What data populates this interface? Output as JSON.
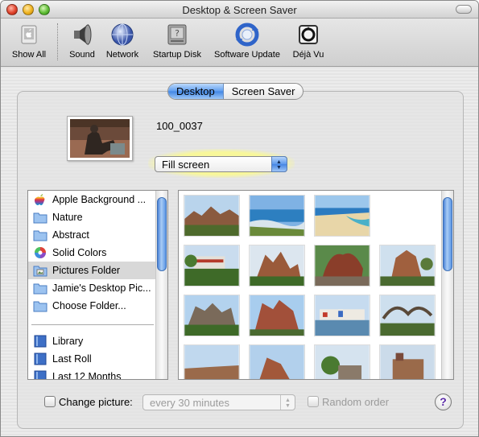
{
  "window": {
    "title": "Desktop & Screen Saver"
  },
  "toolbar": {
    "items": [
      {
        "label": "Show All",
        "icon": "show-all-icon"
      },
      {
        "label": "Sound",
        "icon": "speaker-icon"
      },
      {
        "label": "Network",
        "icon": "network-globe-icon"
      },
      {
        "label": "Startup Disk",
        "icon": "hard-disk-icon"
      },
      {
        "label": "Software Update",
        "icon": "software-update-icon"
      },
      {
        "label": "Déjà Vu",
        "icon": "deja-vu-icon"
      }
    ]
  },
  "tabs": [
    {
      "label": "Desktop",
      "active": true
    },
    {
      "label": "Screen Saver",
      "active": false
    }
  ],
  "current_picture": {
    "name": "100_0037"
  },
  "fill_mode": {
    "selected": "Fill screen",
    "highlight_color": "#f8f79a"
  },
  "sources": {
    "items": [
      {
        "label": "Apple Background ...",
        "icon": "apple-icon"
      },
      {
        "label": "Nature",
        "icon": "folder-icon"
      },
      {
        "label": "Abstract",
        "icon": "folder-icon"
      },
      {
        "label": "Solid Colors",
        "icon": "color-wheel-icon"
      },
      {
        "label": "Pictures Folder",
        "icon": "pictures-folder-icon",
        "selected": true
      },
      {
        "label": "Jamie's Desktop Pic...",
        "icon": "folder-icon"
      },
      {
        "label": "Choose Folder...",
        "icon": "folder-icon"
      }
    ],
    "library": [
      {
        "label": "Library",
        "icon": "iphoto-library-icon"
      },
      {
        "label": "Last Roll",
        "icon": "iphoto-album-icon"
      },
      {
        "label": "Last 12 Months",
        "icon": "iphoto-album-icon"
      }
    ]
  },
  "options": {
    "change_picture_label": "Change picture:",
    "change_picture_checked": false,
    "interval_value": "every 30 minutes",
    "random_order_label": "Random order",
    "random_order_checked": false,
    "help_label": "?"
  },
  "colors": {
    "accent_blue": "#3f85e4",
    "selection_gray": "#d8d8d8"
  }
}
